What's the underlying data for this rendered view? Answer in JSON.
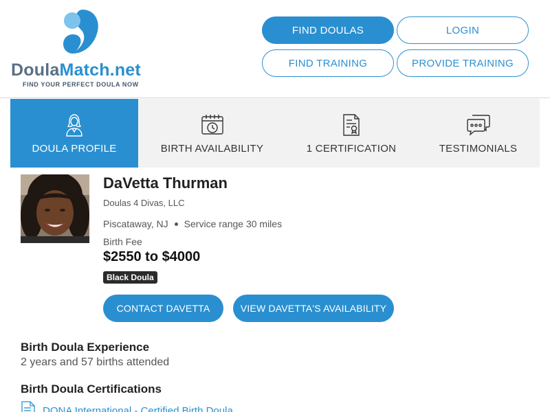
{
  "logo": {
    "name_part1": "Doula",
    "name_part2": "Match.net",
    "tagline": "FIND YOUR PERFECT DOULA NOW"
  },
  "header_nav": {
    "find_doulas": "FIND DOULAS",
    "login": "LOGIN",
    "find_training": "FIND TRAINING",
    "provide_training": "PROVIDE TRAINING"
  },
  "tabs": [
    {
      "label": "DOULA PROFILE",
      "icon": "doula-profile-icon",
      "active": true
    },
    {
      "label": "BIRTH AVAILABILITY",
      "icon": "calendar-clock-icon",
      "active": false
    },
    {
      "label": "1 CERTIFICATION",
      "icon": "certificate-icon",
      "active": false
    },
    {
      "label": "TESTIMONIALS",
      "icon": "chat-bubbles-icon",
      "active": false
    }
  ],
  "profile": {
    "name": "DaVetta Thurman",
    "organization": "Doulas 4 Divas, LLC",
    "location": "Piscataway, NJ",
    "service_range": "Service range 30 miles",
    "fee_label": "Birth Fee",
    "fee": "$2550 to $4000",
    "badge": "Black Doula",
    "contact_button": "CONTACT DAVETTA",
    "availability_button": "VIEW DAVETTA'S AVAILABILITY"
  },
  "experience": {
    "title": "Birth Doula Experience",
    "text": "2 years and 57 births attended"
  },
  "certifications": {
    "title": "Birth Doula Certifications",
    "first_item": "DONA International - Certified Birth Doula"
  },
  "colors": {
    "brand_blue": "#2a8fd0",
    "tab_bg": "#f2f2f2",
    "badge_bg": "#2b2b2b"
  }
}
